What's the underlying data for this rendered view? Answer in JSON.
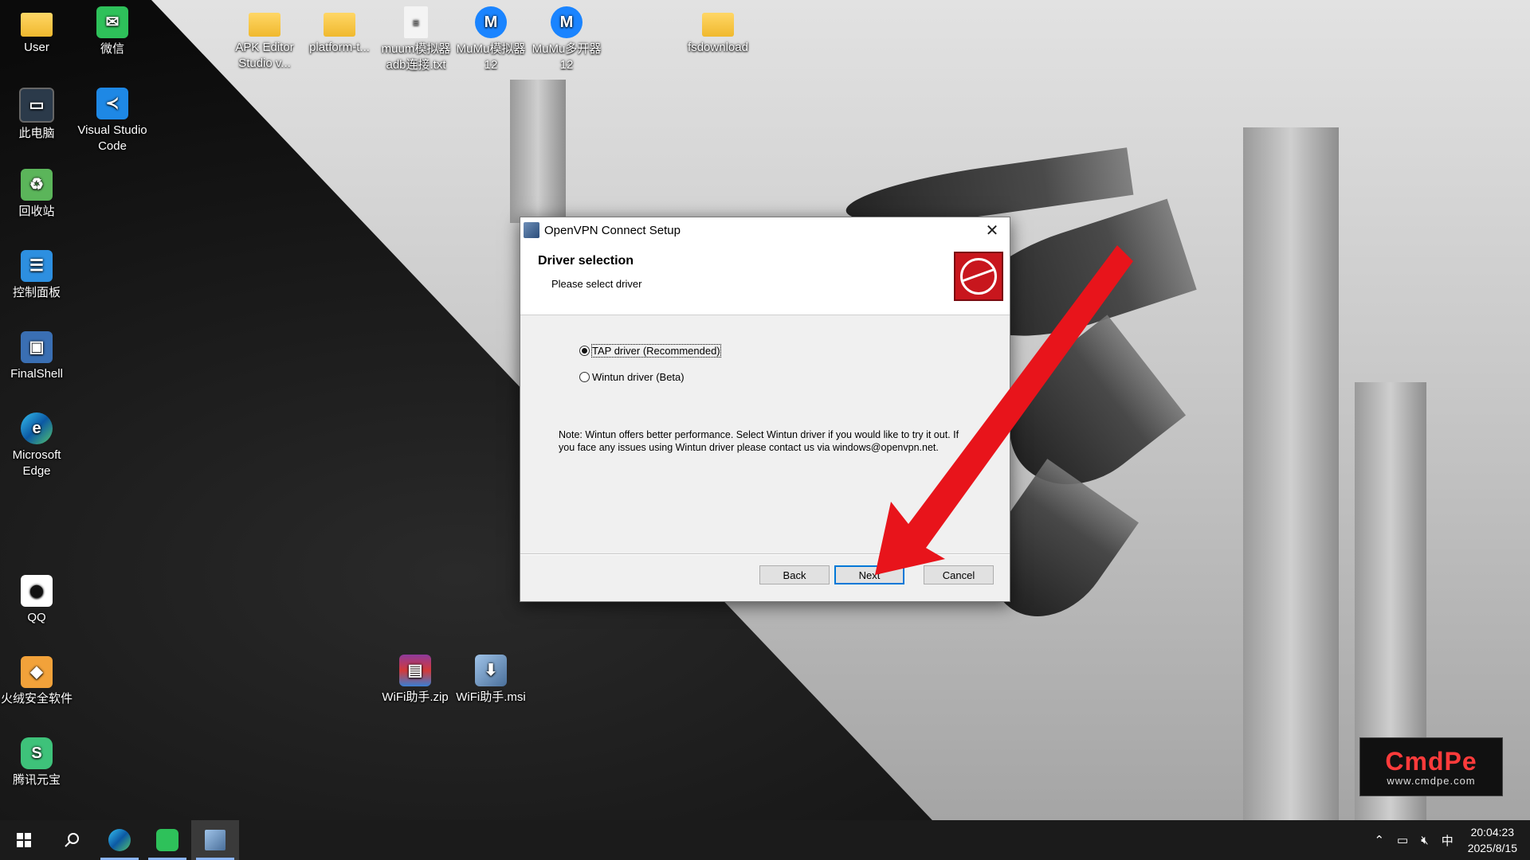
{
  "desktop": {
    "icons": [
      {
        "label": "User",
        "icon": "user-folder-icon"
      },
      {
        "label": "微信",
        "icon": "wechat-icon"
      },
      {
        "label": "APK Editor Studio v...",
        "icon": "folder-icon"
      },
      {
        "label": "platform-t...",
        "icon": "folder-icon"
      },
      {
        "label": "muum模拟器adb连接.txt",
        "icon": "text-file-icon"
      },
      {
        "label": "MuMu模拟器12",
        "icon": "mumu-icon"
      },
      {
        "label": "MuMu多开器12",
        "icon": "mumu-multi-icon"
      },
      {
        "label": "fsdownload",
        "icon": "folder-icon"
      },
      {
        "label": "此电脑",
        "icon": "computer-icon"
      },
      {
        "label": "Visual Studio Code",
        "icon": "vscode-icon"
      },
      {
        "label": "回收站",
        "icon": "recycle-bin-icon"
      },
      {
        "label": "控制面板",
        "icon": "control-panel-icon"
      },
      {
        "label": "FinalShell",
        "icon": "finalshell-icon"
      },
      {
        "label": "Microsoft Edge",
        "icon": "edge-icon"
      },
      {
        "label": "QQ",
        "icon": "qq-icon"
      },
      {
        "label": "火绒安全软件",
        "icon": "huorong-icon"
      },
      {
        "label": "腾讯元宝",
        "icon": "yuanbao-icon"
      },
      {
        "label": "WiFi助手.zip",
        "icon": "winrar-icon"
      },
      {
        "label": "WiFi助手.msi",
        "icon": "msi-installer-icon"
      }
    ]
  },
  "dialog": {
    "title": "OpenVPN Connect Setup",
    "close_glyph": "✕",
    "header_title": "Driver selection",
    "header_subtitle": "Please select driver",
    "options": [
      {
        "label": "TAP driver (Recommended)",
        "checked": true
      },
      {
        "label": "Wintun driver (Beta)",
        "checked": false
      }
    ],
    "note": "Note: Wintun offers better performance. Select Wintun driver if you would like to try it out. If you face any issues using Wintun driver please contact us via windows@openvpn.net.",
    "buttons": {
      "back": "Back",
      "next": "Next",
      "cancel": "Cancel"
    }
  },
  "watermark": {
    "brand": "CmdPe",
    "url": "www.cmdpe.com"
  },
  "taskbar": {
    "apps": [
      "start-icon",
      "search-icon",
      "edge-icon",
      "wechat-icon",
      "installer-icon"
    ],
    "tray": {
      "ime": "中",
      "time": "20:04:23",
      "date": "2025/8/15"
    }
  },
  "colors": {
    "arrow": "#e8141b",
    "accent": "#0078d7",
    "taskbar": "#1b1b1b",
    "logo_red": "#c8161d"
  }
}
